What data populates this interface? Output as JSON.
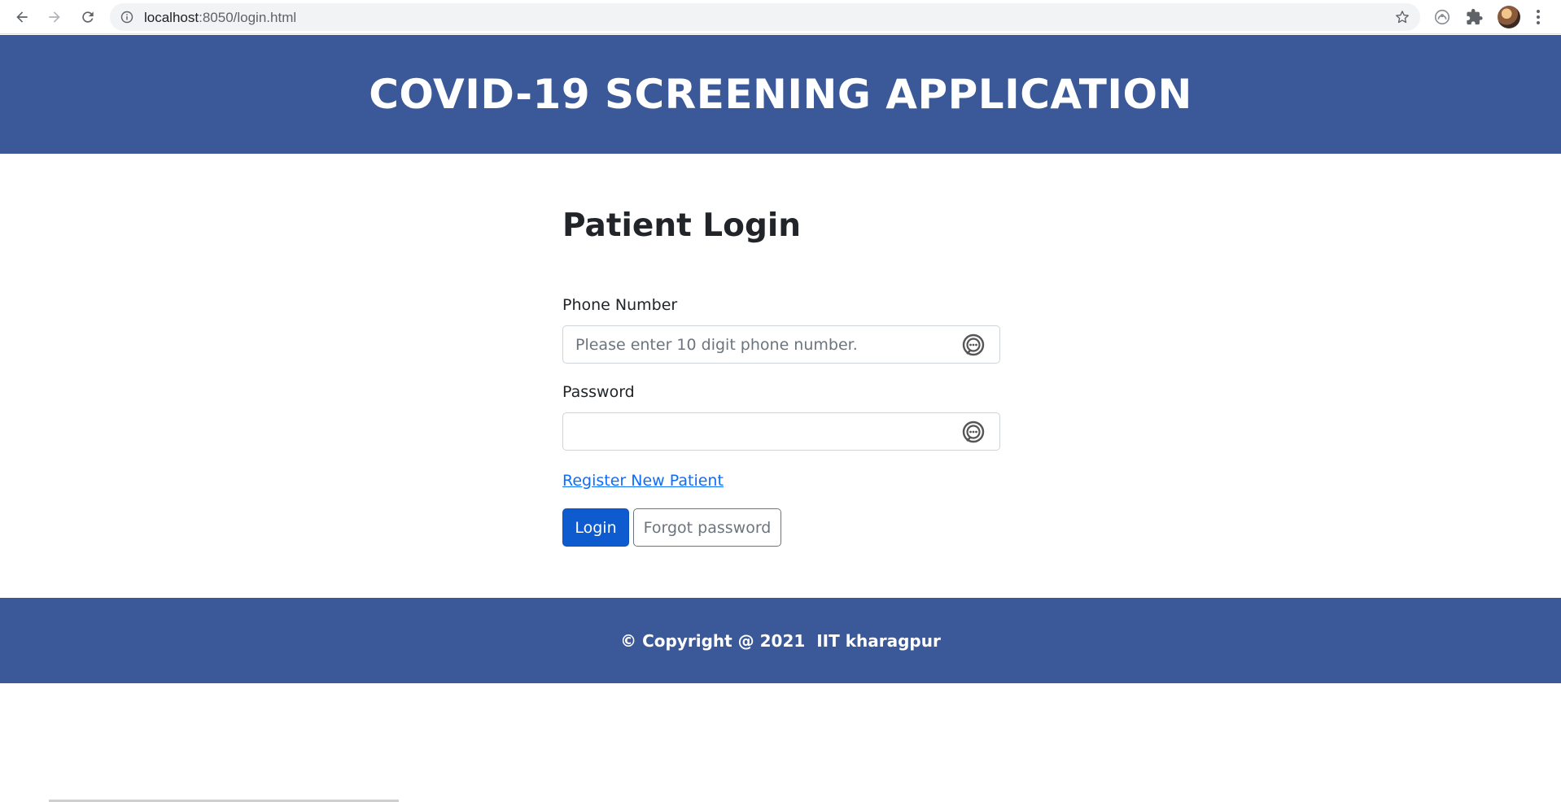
{
  "browser": {
    "url_host": "localhost",
    "url_path": ":8050/login.html"
  },
  "header": {
    "title": "COVID-19 SCREENING APPLICATION"
  },
  "login": {
    "title": "Patient Login",
    "phone_label": "Phone Number",
    "phone_placeholder": "Please enter 10 digit phone number.",
    "phone_value": "",
    "password_label": "Password",
    "password_value": "",
    "register_link": "Register New Patient",
    "login_button": "Login",
    "forgot_button": "Forgot password"
  },
  "footer": {
    "copyright": "© Copyright @ 2021  IIT kharagpur"
  },
  "colors": {
    "brand": "#3b5998",
    "primary_button": "#0d5bce",
    "link": "#0d6efd"
  },
  "icons": [
    "back-arrow-icon",
    "forward-arrow-icon",
    "reload-icon",
    "info-icon",
    "star-icon",
    "account-icon",
    "puzzle-icon",
    "menu-dots-icon",
    "password-manager-icon"
  ]
}
